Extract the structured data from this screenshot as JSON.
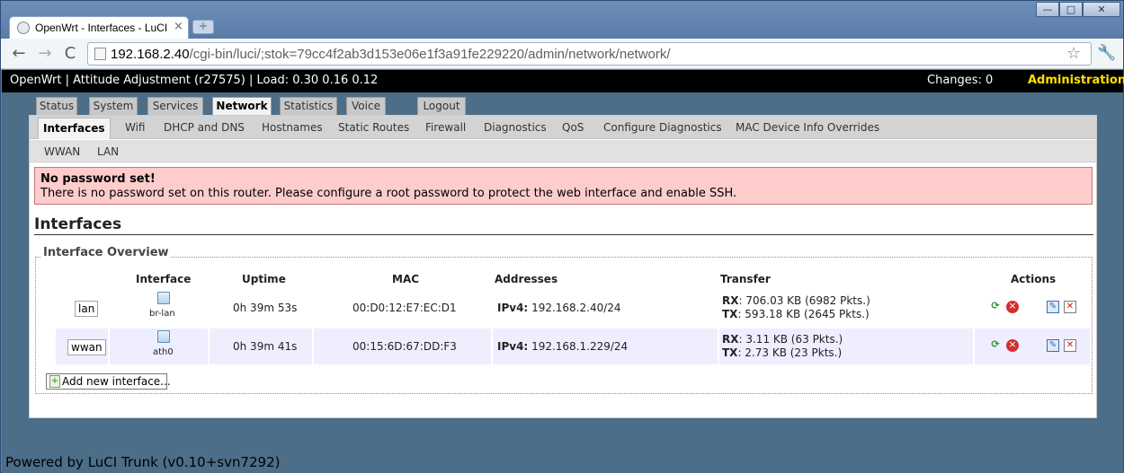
{
  "browser": {
    "tab_title": "OpenWrt - Interfaces - LuCI",
    "tab_close": "×",
    "new_tab": "+",
    "window_controls": {
      "minimize": "—",
      "maximize": "□",
      "close": "✕"
    },
    "nav": {
      "back": "←",
      "forward": "→",
      "reload": "C"
    },
    "url_host": "192.168.2.40",
    "url_path": "/cgi-bin/luci/;stok=79cc4f2ab3d153e06e1f3a91fe229220/admin/network/network/",
    "icons": [
      "back-arrow-icon",
      "forward-arrow-icon",
      "reload-icon",
      "page-icon",
      "star-icon",
      "wrench-icon"
    ]
  },
  "header": {
    "system_info": "OpenWrt | Attitude Adjustment (r27575) | Load: 0.30 0.16 0.12",
    "changes": "Changes: 0",
    "mode": "Administration"
  },
  "main_menu": [
    {
      "label": "Status",
      "active": false
    },
    {
      "label": "System",
      "active": false
    },
    {
      "label": "Services",
      "active": false
    },
    {
      "label": "Network",
      "active": true
    },
    {
      "label": "Statistics",
      "active": false
    },
    {
      "label": "Voice",
      "active": false
    },
    {
      "label": "Logout",
      "active": false
    }
  ],
  "sub_menu": [
    {
      "label": "Interfaces",
      "active": true
    },
    {
      "label": "Wifi",
      "active": false
    },
    {
      "label": "DHCP and DNS",
      "active": false
    },
    {
      "label": "Hostnames",
      "active": false
    },
    {
      "label": "Static Routes",
      "active": false
    },
    {
      "label": "Firewall",
      "active": false
    },
    {
      "label": "Diagnostics",
      "active": false
    },
    {
      "label": "QoS",
      "active": false
    },
    {
      "label": "Configure Diagnostics",
      "active": false
    },
    {
      "label": "MAC Device Info Overrides",
      "active": false
    }
  ],
  "sub_sub_menu": [
    "WWAN",
    "LAN"
  ],
  "alert": {
    "title": "No password set!",
    "message": "There is no password set on this router. Please configure a root password to protect the web interface and enable SSH."
  },
  "section": {
    "title": "Interfaces",
    "legend": "Interface Overview"
  },
  "table": {
    "headers": [
      "Interface",
      "Uptime",
      "MAC",
      "Addresses",
      "Transfer",
      "Actions"
    ],
    "rows": [
      {
        "network": "lan",
        "device": "br-lan",
        "uptime": "0h 39m 53s",
        "mac": "00:D0:12:E7:EC:D1",
        "addr_label": "IPv4:",
        "addr_value": "192.168.2.40/24",
        "rx_label": "RX",
        "rx_value": ": 706.03 KB (6982 Pkts.)",
        "tx_label": "TX",
        "tx_value": ": 593.18 KB (2645 Pkts.)"
      },
      {
        "network": "wwan",
        "device": "ath0",
        "uptime": "0h 39m 41s",
        "mac": "00:15:6D:67:DD:F3",
        "addr_label": "IPv4:",
        "addr_value": "192.168.1.229/24",
        "rx_label": "RX",
        "rx_value": ": 3.11 KB (63 Pkts.)",
        "tx_label": "TX",
        "tx_value": ": 2.73 KB (23 Pkts.)"
      }
    ],
    "action_icons": {
      "reconnect": "⟳",
      "shutdown": "×",
      "edit": "✎",
      "delete": "✕"
    }
  },
  "add_button": "Add new interface...",
  "add_icon": "+",
  "footer": "Powered by LuCI Trunk (v0.10+svn7292)"
}
